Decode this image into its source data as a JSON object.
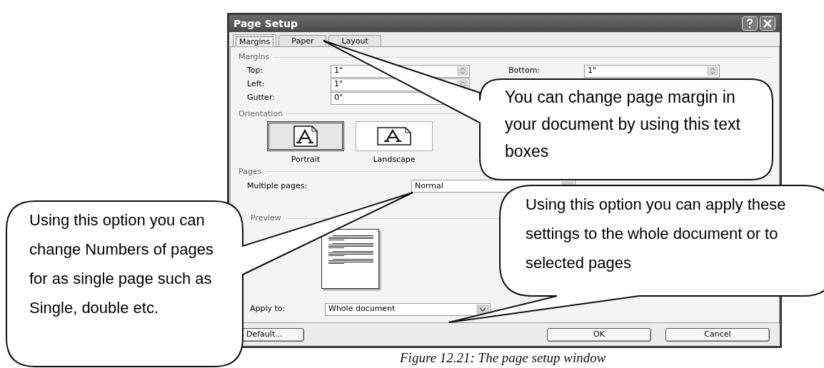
{
  "dialog": {
    "title": "Page Setup",
    "tabs": [
      {
        "label": "Margins",
        "selected": true
      },
      {
        "label": "Paper",
        "selected": false
      },
      {
        "label": "Layout",
        "selected": false
      }
    ],
    "margins": {
      "heading": "Margins",
      "fields": [
        {
          "label": "Top:",
          "value": "1\""
        },
        {
          "label": "Left:",
          "value": "1\""
        },
        {
          "label": "Gutter:",
          "value": "0\""
        }
      ],
      "bottom": {
        "label": "Bottom:",
        "value": "1\""
      }
    },
    "orientation": {
      "heading": "Orientation",
      "options": [
        {
          "label": "Portrait",
          "selected": true,
          "kind": "portrait"
        },
        {
          "label": "Landscape",
          "selected": false,
          "kind": "landscape"
        }
      ]
    },
    "pages": {
      "heading": "Pages",
      "label": "Multiple pages:",
      "value": "Normal"
    },
    "preview": {
      "heading": "Preview",
      "apply_label": "Apply to:",
      "apply_value": "Whole document"
    },
    "buttons": [
      {
        "label": "Default...",
        "kind": "default"
      },
      {
        "label": "OK",
        "kind": "ok"
      },
      {
        "label": "Cancel",
        "kind": "cancel"
      }
    ]
  },
  "callouts": [
    "You can change page margin in your document by using this text boxes",
    "Using this option you can change Numbers of pages for as single page such as Single, double etc.",
    "Using this option you can apply these settings to the whole document or to selected pages"
  ],
  "caption": "Figure 12.21: The page setup window"
}
